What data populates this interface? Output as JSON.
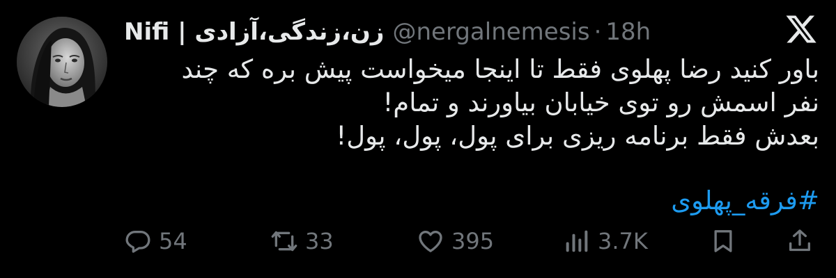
{
  "user": {
    "display_name": "Nifi | زن،زندگی،آزادی",
    "handle": "@nergalnemesis",
    "separator": "·",
    "time": "18h"
  },
  "icons": {
    "logo": "x-logo-icon",
    "reply": "reply-icon",
    "retweet": "retweet-icon",
    "like": "heart-icon",
    "views": "analytics-icon",
    "bookmark": "bookmark-icon",
    "share": "share-icon"
  },
  "body_lines": [
    "باور کنید رضا پهلوی فقط تا اینجا میخواست پیش بره که چند",
    "نفر اسمش رو توی خیابان بیاورند و تمام!",
    "بعدش فقط برنامه ریزی برای پول، پول، پول!"
  ],
  "hashtag": "#فرقه_پهلوی",
  "stats": {
    "replies": "54",
    "retweets": "33",
    "likes": "395",
    "views": "3.7K"
  },
  "colors": {
    "background": "#000000",
    "text": "#e7e9ea",
    "muted": "#71767b",
    "link": "#1d9bf0"
  }
}
